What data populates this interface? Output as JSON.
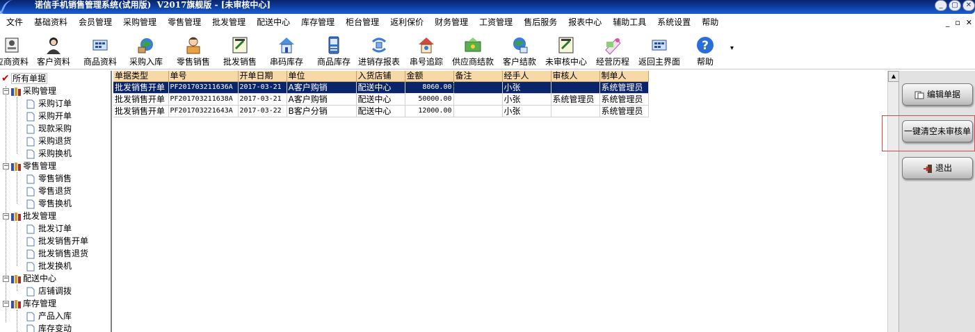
{
  "window": {
    "title": "诺信手机销售管理系统(试用版)  V2017旗舰版 - [未审核中心]",
    "controls": [
      "_",
      "▢",
      "✕"
    ]
  },
  "menu": {
    "items": [
      "文件",
      "基础资料",
      "会员管理",
      "采购管理",
      "零售管理",
      "批发管理",
      "配送中心",
      "库存管理",
      "柜台管理",
      "返利保价",
      "财务管理",
      "工资管理",
      "售后服务",
      "报表中心",
      "辅助工具",
      "系统设置",
      "帮助"
    ],
    "mdi_controls": [
      "_",
      "▫",
      "✕"
    ]
  },
  "toolbar": {
    "buttons": [
      {
        "label": "应商资料",
        "icon": "supplier-icon"
      },
      {
        "label": "客户资料",
        "icon": "customer-icon"
      },
      {
        "label": "商品资料",
        "icon": "product-icon"
      },
      {
        "label": "采购入库",
        "icon": "purchase-in-icon"
      },
      {
        "label": "零售销售",
        "icon": "retail-sale-icon"
      },
      {
        "label": "批发销售",
        "icon": "wholesale-icon"
      },
      {
        "label": "串码库存",
        "icon": "imei-stock-icon"
      },
      {
        "label": "商品库存",
        "icon": "stock-icon"
      },
      {
        "label": "进销存报表",
        "icon": "report-icon"
      },
      {
        "label": "串号追踪",
        "icon": "imei-track-icon"
      },
      {
        "label": "供应商结款",
        "icon": "supplier-payment-icon"
      },
      {
        "label": "客户结款",
        "icon": "customer-payment-icon"
      },
      {
        "label": "未审核中心",
        "icon": "unaudited-icon"
      },
      {
        "label": "经营历程",
        "icon": "history-icon"
      },
      {
        "label": "返回主界面",
        "icon": "home-icon"
      },
      {
        "label": "帮助",
        "icon": "help-icon"
      }
    ],
    "more": "▾"
  },
  "tree": {
    "root": "所有单据",
    "groups": [
      {
        "label": "采购管理",
        "children": [
          "采购订单",
          "采购开单",
          "现款采购",
          "采购退货",
          "采购换机"
        ]
      },
      {
        "label": "零售管理",
        "children": [
          "零售销售",
          "零售退货",
          "零售换机"
        ]
      },
      {
        "label": "批发管理",
        "children": [
          "批发订单",
          "批发销售开单",
          "批发销售退货",
          "批发换机"
        ]
      },
      {
        "label": "配送中心",
        "children": [
          "店铺调拨"
        ]
      },
      {
        "label": "库存管理",
        "children": [
          "产品入库",
          "库存变动"
        ]
      }
    ]
  },
  "grid": {
    "columns": [
      "单据类型",
      "单号",
      "开单日期",
      "单位",
      "入货店铺",
      "金额",
      "备注",
      "经手人",
      "审核人",
      "制单人"
    ],
    "rows": [
      [
        "批发销售开单",
        "PF201703211636A",
        "2017-03-21",
        "A客户购销",
        "配送中心",
        "8060.00",
        "",
        "小张",
        "",
        "系统管理员"
      ],
      [
        "批发销售开单",
        "PF201703211638A",
        "2017-03-21",
        "A客户购销",
        "配送中心",
        "50000.00",
        "",
        "小张",
        "系统管理员",
        "系统管理员"
      ],
      [
        "批发销售开单",
        "PF201703221643A",
        "2017-03-22",
        "B客户分销",
        "配送中心",
        "12000.00",
        "",
        "小张",
        "",
        "系统管理员"
      ]
    ],
    "selected_row": 0
  },
  "actions": {
    "edit": "编辑单据",
    "clear": "一键清空未审核单",
    "exit": "退出"
  },
  "colors": {
    "title_bar": "#0b3b9b",
    "header_bg": "#f7d9a8",
    "selection": "#0a246a",
    "highlight_border": "#d04a4a"
  }
}
